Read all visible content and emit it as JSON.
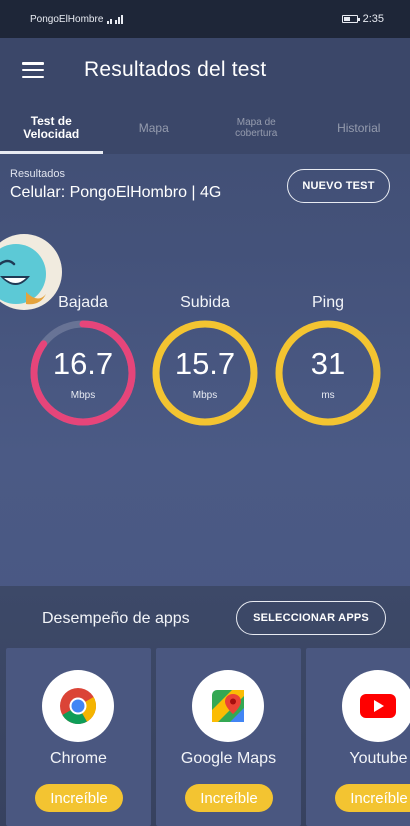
{
  "status_bar": {
    "carrier": "PongoElHombre",
    "time": "2:35"
  },
  "app_bar": {
    "title": "Resultados del test",
    "menu_icon": "hamburger-menu-icon"
  },
  "tabs": [
    {
      "label_line1": "Test de",
      "label_line2": "Velocidad",
      "active": true
    },
    {
      "label_line1": "Mapa",
      "label_line2": "",
      "active": false
    },
    {
      "label_line1": "Mapa de",
      "label_line2": "cobertura",
      "active": false
    },
    {
      "label_line1": "Historial",
      "label_line2": "",
      "active": false
    }
  ],
  "results": {
    "label": "Resultados",
    "connection": "Celular: PongoElHombro | 4G",
    "new_test_button": "NUEVO TEST"
  },
  "gauges": [
    {
      "label": "Bajada",
      "value": "16.7",
      "unit": "Mbps",
      "color": "#e6457a",
      "fill": 0.85
    },
    {
      "label": "Subida",
      "value": "15.7",
      "unit": "Mbps",
      "color": "#f3c431",
      "fill": 1.0
    },
    {
      "label": "Ping",
      "value": "31",
      "unit": "ms",
      "color": "#f3c431",
      "fill": 1.0
    }
  ],
  "apps": {
    "title": "Desempeño de apps",
    "select_button": "SELECCIONAR APPS",
    "items": [
      {
        "name": "Chrome",
        "rating": "Increíble",
        "icon": "chrome-icon"
      },
      {
        "name": "Google Maps",
        "rating": "Increíble",
        "icon": "google-maps-icon"
      },
      {
        "name": "Youtube",
        "rating": "Increíble",
        "icon": "youtube-icon"
      }
    ]
  },
  "colors": {
    "accent_pink": "#e6457a",
    "accent_yellow": "#f3c431",
    "background": "#44527a"
  }
}
